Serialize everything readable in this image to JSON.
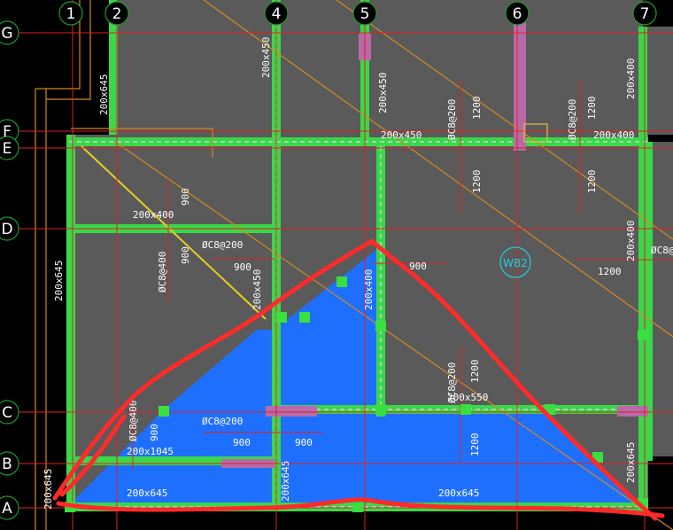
{
  "colors": {
    "background": "#000000",
    "slab": "#5a5a5a",
    "blue_fill": "#1f6fff",
    "beam_green": "#39d84a",
    "beam_dash": "#cfcfcf",
    "grid_red": "#e02020",
    "orange_line": "#d08a20",
    "yellow_line": "#e8d020",
    "highlight": "#ff2a2a",
    "pink": "#b86aa8",
    "cyan": "#20d0e0"
  },
  "col_axes": [
    "1",
    "2",
    "4",
    "5",
    "6",
    "7"
  ],
  "row_axes": [
    "G",
    "F",
    "E",
    "D",
    "C",
    "B",
    "A"
  ],
  "beam_labels": [
    "200x645",
    "200x450",
    "200x450",
    "200x400",
    "200x450",
    "200x400",
    "200x400",
    "200x645",
    "200x450",
    "200x400",
    "200x400",
    "200x550",
    "200x1045",
    "200x645",
    "200x645",
    "200x645",
    "200x645",
    "200x645"
  ],
  "rebar_labels": [
    "ØC8@200",
    "ØC8@200",
    "ØC8@200",
    "ØC8@400",
    "ØC8@200",
    "ØC8@400",
    "ØC8@200",
    "ØC8@"
  ],
  "dims": [
    "1200",
    "1200",
    "1200",
    "1200",
    "1200",
    "1200",
    "1200",
    "900",
    "900",
    "900",
    "900",
    "900",
    "900",
    "900"
  ],
  "slab_tag": "WB2"
}
